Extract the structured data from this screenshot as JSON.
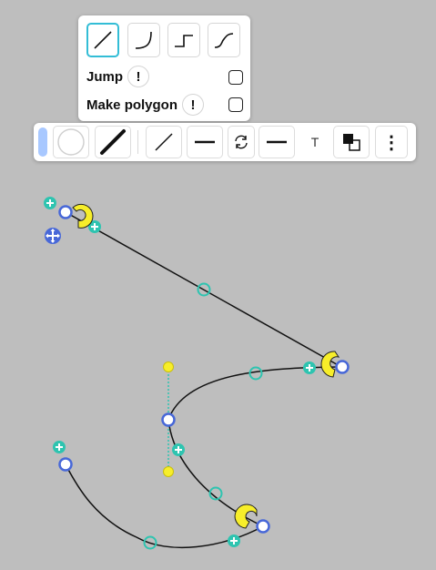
{
  "edge_style_menu": {
    "styles": [
      {
        "name": "straight",
        "icon": "straight-line-icon",
        "selected": true
      },
      {
        "name": "curved",
        "icon": "curved-line-icon",
        "selected": false
      },
      {
        "name": "orthogonal",
        "icon": "orthogonal-line-icon",
        "selected": false
      },
      {
        "name": "smooth",
        "icon": "s-curve-line-icon",
        "selected": false
      }
    ],
    "jump_label": "Jump",
    "jump_checked": false,
    "polygon_label": "Make polygon",
    "polygon_checked": false,
    "help_glyph": "!"
  },
  "toolbar": {
    "text_tool_glyph": "T",
    "more_glyph": "⋮",
    "fill_color": "#a8c8ff",
    "items": [
      "fill-color",
      "line-color",
      "line-width",
      "line-style",
      "arrow-start",
      "swap-direction",
      "arrow-end",
      "text",
      "arrange",
      "more"
    ]
  },
  "colors": {
    "canvas_bg": "#bebebe",
    "accent": "#33bdd6",
    "vertex_blue": "#4868d8",
    "midpoint_teal": "#2ec4b0",
    "handle_yellow": "#f7ee2a",
    "edge": "#111111"
  }
}
